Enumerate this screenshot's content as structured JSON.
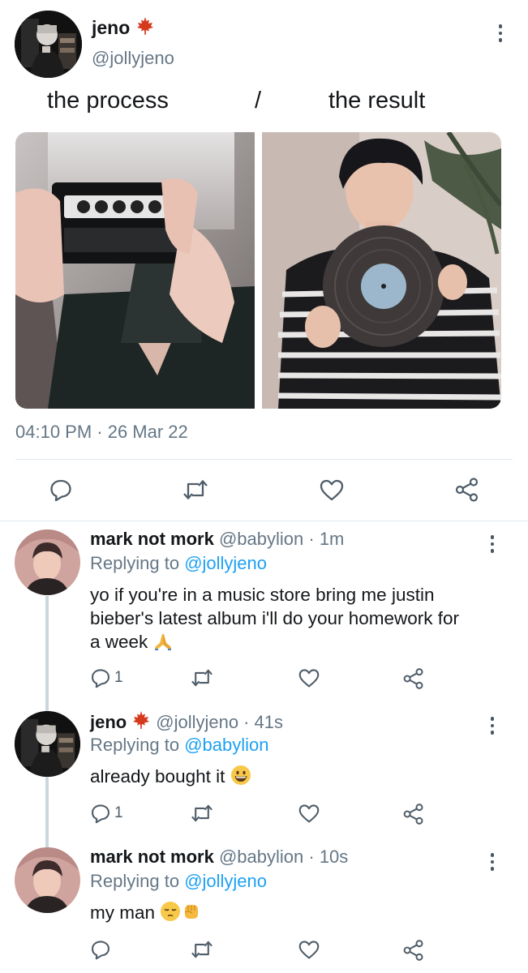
{
  "tweet": {
    "author_name": "jeno",
    "author_badge": "maple-leaf-emoji",
    "author_handle": "@jollyjeno",
    "text_left": "the process",
    "text_sep": "/",
    "text_right": "the result",
    "images": [
      {
        "subject": "person holding a film camera in front of face"
      },
      {
        "subject": "person holding a vinyl record"
      }
    ],
    "timestamp": "04:10 PM · 26 Mar 22",
    "actions": {
      "reply_icon": "reply-icon",
      "retweet_icon": "retweet-icon",
      "like_icon": "like-icon",
      "share_icon": "share-icon"
    }
  },
  "replies": [
    {
      "author_name": "mark not mork",
      "author_handle": "@babylion",
      "time": "· 1m",
      "replying_prefix": "Replying to ",
      "replying_to": "@jollyjeno",
      "text_lines": [
        "yo if you're in a music store bring me justin",
        "bieber's latest album i'll do your homework for",
        "a week"
      ],
      "emoji": "folded-hands-emoji",
      "reply_count": "1"
    },
    {
      "author_name": "jeno",
      "author_badge": "maple-leaf-emoji",
      "author_handle": "@jollyjeno",
      "time": "· 41s",
      "replying_prefix": "Replying to ",
      "replying_to": "@babylion",
      "text": "already bought it",
      "emoji": "grinning-face-emoji",
      "reply_count": "1"
    },
    {
      "author_name": "mark not mork",
      "author_handle": "@babylion",
      "time": "· 10s",
      "replying_prefix": "Replying to ",
      "replying_to": "@jollyjeno",
      "text": "my man",
      "emoji": "pensive-face-and-raised-fist-emoji",
      "reply_count": ""
    }
  ],
  "colors": {
    "link": "#1da1f2",
    "secondary_text": "#657786",
    "icon": "#4f5d69",
    "divider": "#e1e8ed",
    "thread_line": "#ccd6dd"
  }
}
